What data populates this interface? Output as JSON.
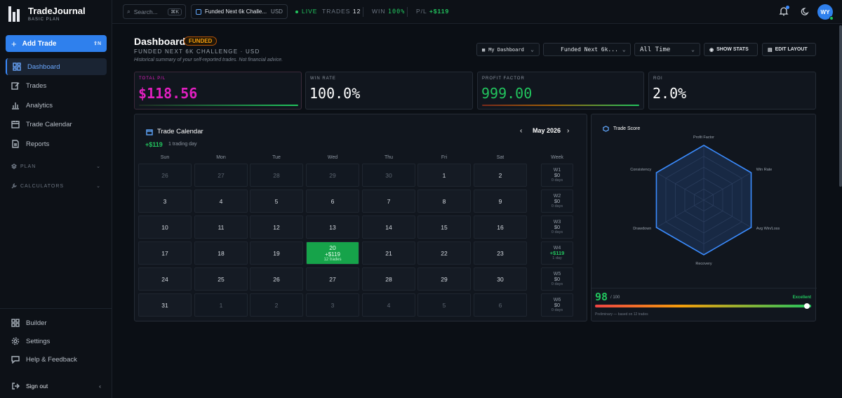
{
  "brand": {
    "name": "TradeJournal",
    "plan": "BASIC PLAN"
  },
  "sidebar": {
    "add_trade": {
      "label": "Add Trade",
      "shortcut": "⇧N"
    },
    "items": [
      {
        "label": "Dashboard",
        "icon": "dashboard-icon",
        "active": true
      },
      {
        "label": "Trades",
        "icon": "edit-icon"
      },
      {
        "label": "Analytics",
        "icon": "bar-chart-icon"
      },
      {
        "label": "Trade Calendar",
        "icon": "calendar-icon"
      },
      {
        "label": "Reports",
        "icon": "report-icon"
      }
    ],
    "sections": [
      {
        "label": "PLAN"
      },
      {
        "label": "CALCULATORS"
      }
    ],
    "bottom_items": [
      {
        "label": "Builder",
        "icon": "grid-icon"
      },
      {
        "label": "Settings",
        "icon": "gear-icon"
      },
      {
        "label": "Help & Feedback",
        "icon": "chat-icon"
      }
    ],
    "sign_out": "Sign out"
  },
  "topbar": {
    "search_placeholder": "Search...",
    "search_shortcut": "⌘K",
    "account": "Funded Next 6k Challe...",
    "currency": "USD",
    "live": "LIVE",
    "trades_label": "TRADES",
    "trades_value": "12",
    "win_label": "WIN",
    "win_value": "100%",
    "pl_label": "P/L",
    "pl_value": "+$119",
    "avatar": "WY"
  },
  "header": {
    "title": "Dashboard",
    "badge": "FUNDED",
    "subtitle": "FUNDED NEXT 6K CHALLENGE · USD",
    "description": "Historical summary of your self-reported trades. Not financial advice.",
    "dashboard_select": "My Dashboard",
    "account_select": "Funded Next 6k...",
    "period_select": "All Time",
    "show_stats": "SHOW STATS",
    "edit_layout": "EDIT LAYOUT"
  },
  "stats": [
    {
      "label": "TOTAL P/L",
      "value": "$118.56",
      "color": "#e11fbf"
    },
    {
      "label": "WIN RATE",
      "value": "100.0%",
      "color": "#ffffff"
    },
    {
      "label": "PROFIT FACTOR",
      "value": "999.00",
      "color": "#22c55e"
    },
    {
      "label": "ROI",
      "value": "2.0%",
      "color": "#ffffff"
    }
  ],
  "calendar": {
    "title": "Trade Calendar",
    "pl": "+$119",
    "trading_days": "1 trading day",
    "month": "May 2026",
    "dow": [
      "Sun",
      "Mon",
      "Tue",
      "Wed",
      "Thu",
      "Fri",
      "Sat",
      "Week"
    ],
    "weeks": [
      {
        "days": [
          "26",
          "27",
          "28",
          "29",
          "30",
          "1",
          "2"
        ],
        "dim": [
          1,
          1,
          1,
          1,
          1,
          0,
          0
        ],
        "label": "W1",
        "amount": "$0",
        "count": "0 days"
      },
      {
        "days": [
          "3",
          "4",
          "5",
          "6",
          "7",
          "8",
          "9"
        ],
        "dim": [
          0,
          0,
          0,
          0,
          0,
          0,
          0
        ],
        "label": "W2",
        "amount": "$0",
        "count": "0 days"
      },
      {
        "days": [
          "10",
          "11",
          "12",
          "13",
          "14",
          "15",
          "16"
        ],
        "dim": [
          0,
          0,
          0,
          0,
          0,
          0,
          0
        ],
        "label": "W3",
        "amount": "$0",
        "count": "0 days"
      },
      {
        "days": [
          "17",
          "18",
          "19",
          "20",
          "21",
          "22",
          "23"
        ],
        "dim": [
          0,
          0,
          0,
          0,
          0,
          0,
          0
        ],
        "label": "W4",
        "amount": "+$119",
        "count": "1 day"
      },
      {
        "days": [
          "24",
          "25",
          "26",
          "27",
          "28",
          "29",
          "30"
        ],
        "dim": [
          0,
          0,
          0,
          0,
          0,
          0,
          0
        ],
        "label": "W5",
        "amount": "$0",
        "count": "0 days"
      },
      {
        "days": [
          "31",
          "1",
          "2",
          "3",
          "4",
          "5",
          "6"
        ],
        "dim": [
          0,
          1,
          1,
          1,
          1,
          1,
          1
        ],
        "label": "W6",
        "amount": "$0",
        "count": "0 days"
      }
    ],
    "highlight": {
      "day": "20",
      "pl": "+$119",
      "trades": "12 trades"
    }
  },
  "score": {
    "title": "Trade Score",
    "axes": [
      "Profit Factor",
      "Win Rate",
      "Avg Win/Loss",
      "Recovery",
      "Drawdown",
      "Consistency"
    ],
    "value": "98",
    "max": "/ 100",
    "grade": "Excellent",
    "level": 0.98,
    "note": "Preliminary — based on 12 trades"
  }
}
